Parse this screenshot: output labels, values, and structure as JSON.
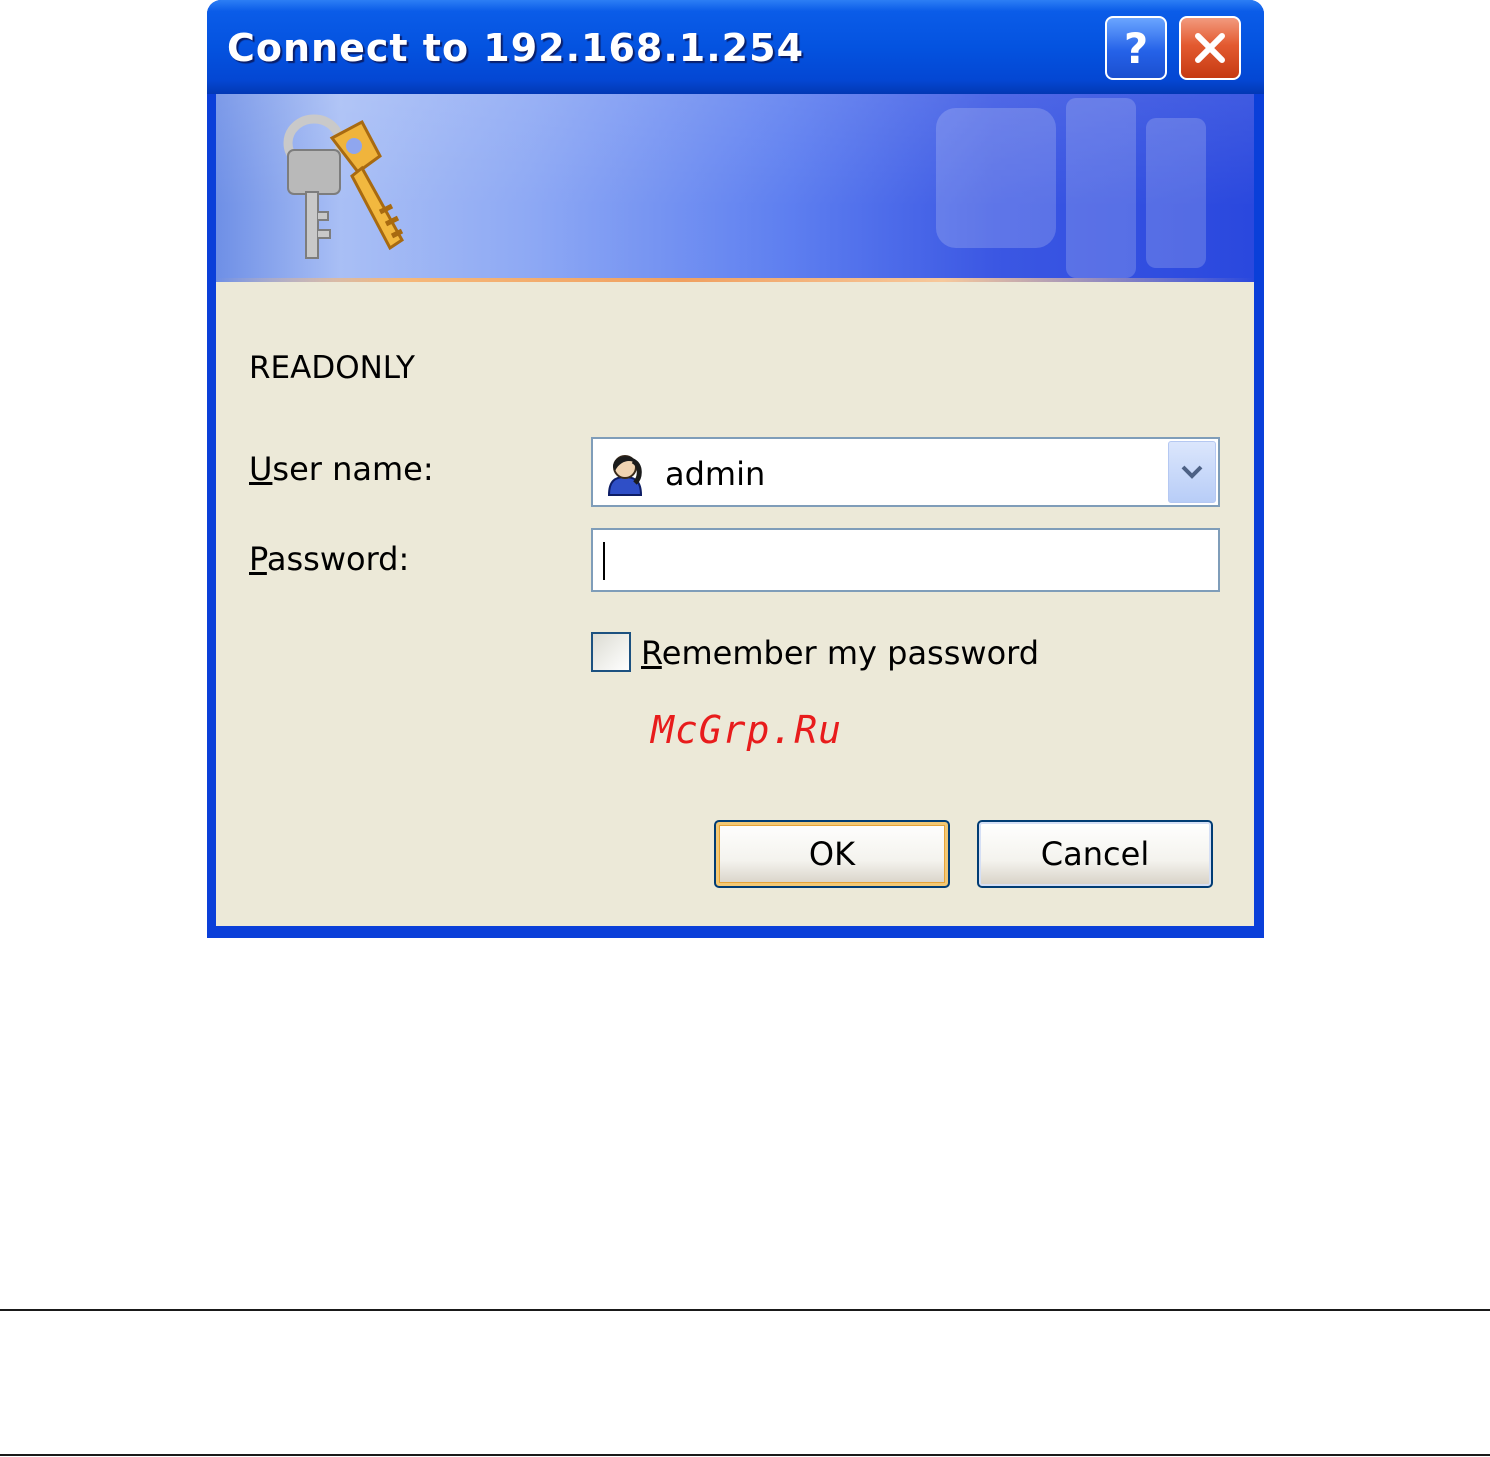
{
  "dialog": {
    "title": "Connect to 192.168.1.254",
    "help_button_glyph": "?",
    "close_button_icon": "close-icon",
    "banner_icon": "keys-icon"
  },
  "form": {
    "realm": "READONLY",
    "username_label_prefix": "U",
    "username_label_rest": "ser name:",
    "username_value": "admin",
    "username_icon": "user-icon",
    "password_label_prefix": "P",
    "password_label_rest": "assword:",
    "password_value": "",
    "remember_label_prefix": "R",
    "remember_label_rest": "emember my password",
    "remember_checked": false
  },
  "buttons": {
    "ok": "OK",
    "cancel": "Cancel"
  },
  "watermark": "McGrp.Ru",
  "colors": {
    "titlebar": "#0453e0",
    "dialog_body": "#ece9d8",
    "close_button": "#e35a30",
    "watermark": "#e81c1c"
  }
}
